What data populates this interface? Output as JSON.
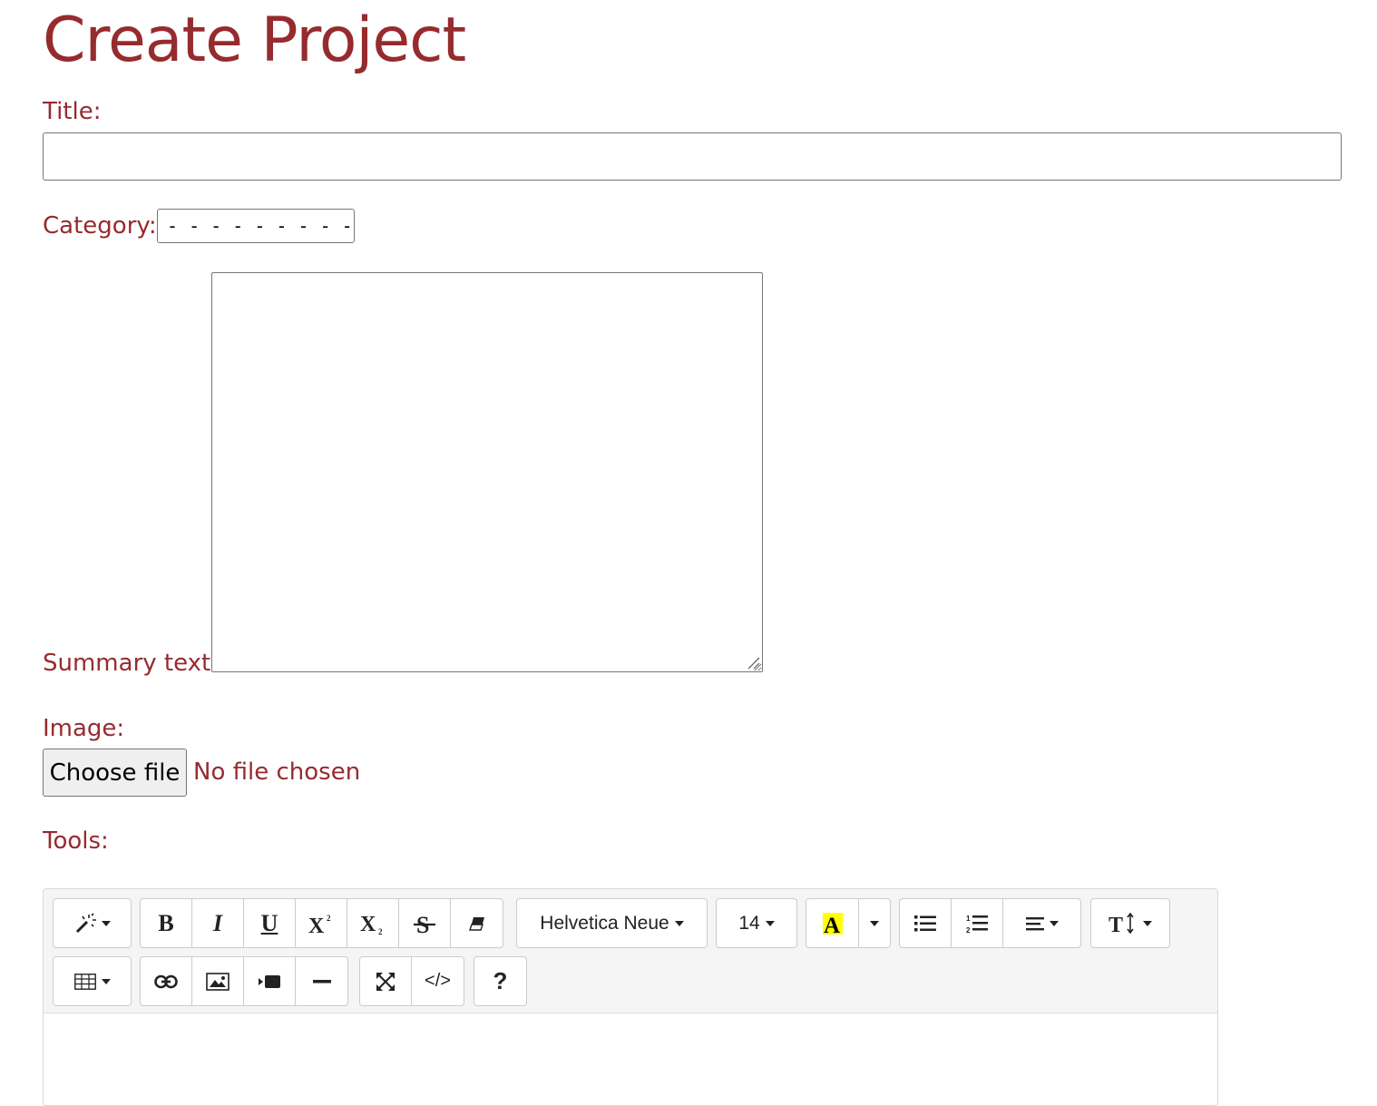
{
  "page": {
    "title": "Create Project"
  },
  "form": {
    "title_label": "Title:",
    "title_value": "",
    "category_label": "Category:",
    "category_selected": "---------",
    "summary_label": "Summary text:",
    "summary_value": "",
    "image_label": "Image:",
    "file_button": "Choose file",
    "file_status": "No file chosen",
    "tools_label": "Tools:"
  },
  "editor": {
    "font_name": "Helvetica Neue",
    "font_size": "14",
    "toolbar_row1": [
      "magic-icon",
      "bold-icon",
      "italic-icon",
      "underline-icon",
      "superscript-icon",
      "subscript-icon",
      "strikethrough-icon",
      "eraser-icon",
      "font-name",
      "font-size",
      "text-color-icon",
      "color-dropdown",
      "unordered-list-icon",
      "ordered-list-icon",
      "align-icon",
      "line-height-icon"
    ],
    "toolbar_row2": [
      "table-icon",
      "link-icon",
      "picture-icon",
      "video-icon",
      "hr-icon",
      "fullscreen-icon",
      "code-view-icon",
      "help-icon"
    ],
    "glyphs": {
      "bold": "B",
      "italic": "I",
      "underline": "U",
      "help": "?",
      "code": "</>"
    },
    "highlight_color": "#ffff00"
  },
  "colors": {
    "accent": "#962b2e"
  }
}
